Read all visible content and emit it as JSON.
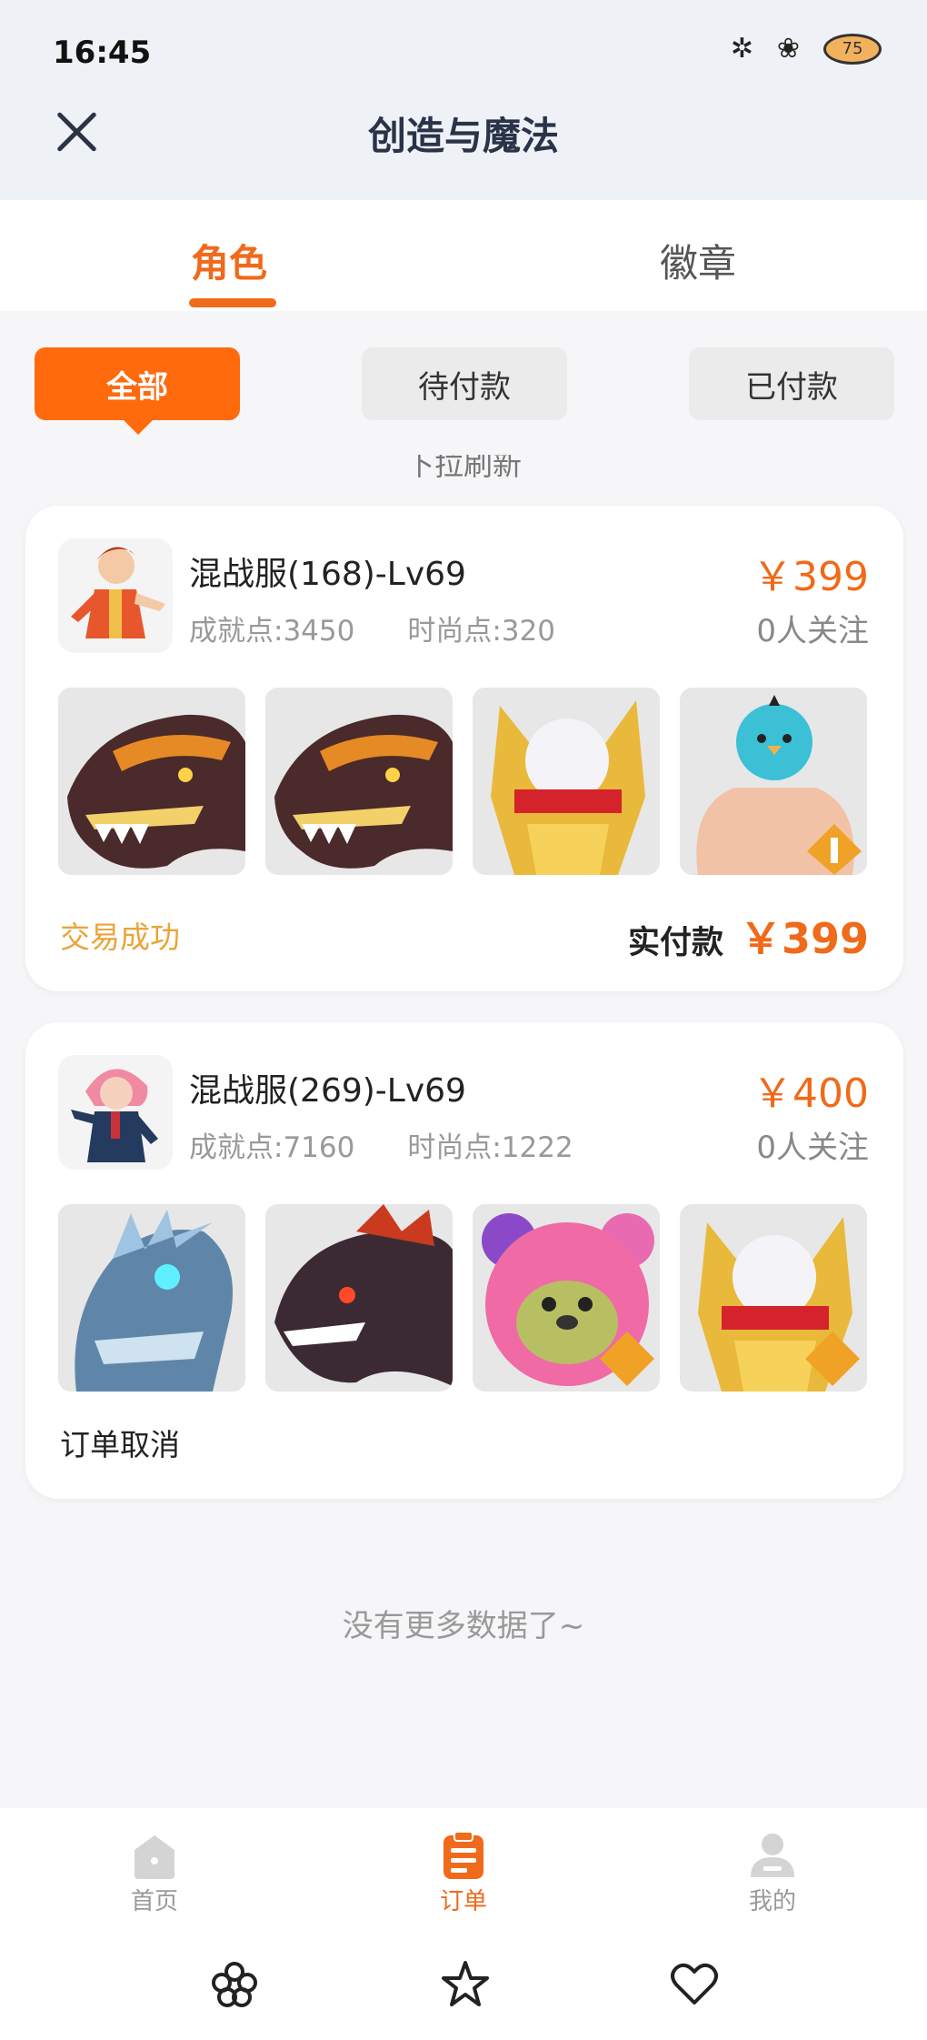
{
  "status_bar": {
    "time": "16:45",
    "battery": "75"
  },
  "header": {
    "title": "创造与魔法"
  },
  "tabs": [
    {
      "label": "角色",
      "active": true
    },
    {
      "label": "徽章",
      "active": false
    }
  ],
  "filters": [
    {
      "label": "全部",
      "active": true
    },
    {
      "label": "待付款",
      "active": false
    },
    {
      "label": "已付款",
      "active": false
    }
  ],
  "pull_hint": "下拉刷新",
  "orders": [
    {
      "title": "混战服(168)-Lv69",
      "achievement": "成就点:3450",
      "fashion": "时尚点:320",
      "price": "￥399",
      "followers": "0人关注",
      "items": [
        "dragon-head",
        "dragon-head",
        "golden-helmet",
        "blue-bird-mount"
      ],
      "status": "交易成功",
      "paid_label": "实付款",
      "paid_value": "￥399"
    },
    {
      "title": "混战服(269)-Lv69",
      "achievement": "成就点:7160",
      "fashion": "时尚点:1222",
      "price": "￥400",
      "followers": "0人关注",
      "items": [
        "ice-dragon",
        "fire-dragon",
        "pink-bear",
        "golden-helmet"
      ],
      "status": "订单取消"
    }
  ],
  "footer": {
    "no_more": "没有更多数据了~"
  },
  "bottom_nav": [
    {
      "label": "首页",
      "active": false
    },
    {
      "label": "订单",
      "active": true
    },
    {
      "label": "我的",
      "active": false
    }
  ],
  "colors": {
    "accent": "#ef6a1a",
    "success": "#e9a53a"
  }
}
